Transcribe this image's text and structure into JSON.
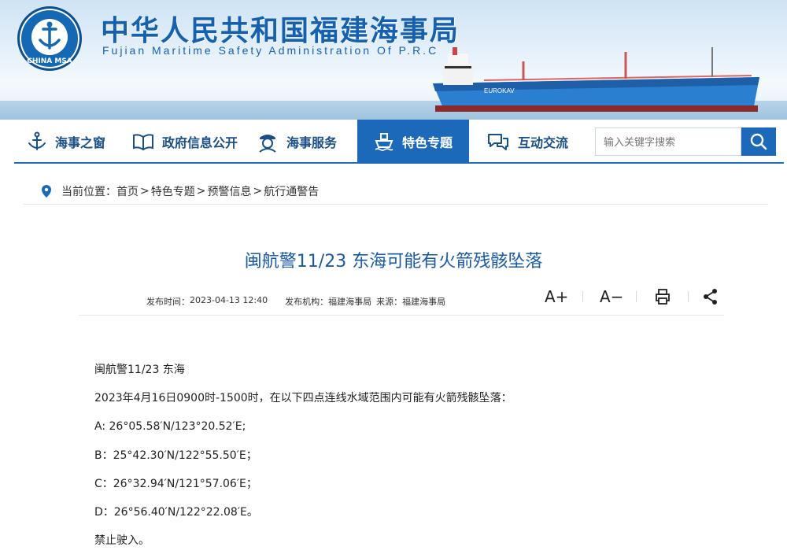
{
  "header": {
    "title": "中华人民共和国福建海事局",
    "subtitle": "Fujian Maritime Safety Administration Of P.R.C",
    "logo_text": "CHINA MSA",
    "logo_ring_text": "中国海事局",
    "ship_name": "EUROKAV",
    "logo_color": "#1468b4"
  },
  "nav": {
    "items": [
      {
        "label": "海事之窗",
        "icon": "anchor-icon"
      },
      {
        "label": "政府信息公开",
        "icon": "book-icon"
      },
      {
        "label": "海事服务",
        "icon": "officer-icon"
      },
      {
        "label": "特色专题",
        "icon": "ship-icon",
        "active": true
      },
      {
        "label": "互动交流",
        "icon": "chat-bubbles-icon"
      }
    ],
    "search_placeholder": "输入关键字搜索",
    "active_color": "#1b69b8"
  },
  "breadcrumb": {
    "prefix": "当前位置：",
    "items": [
      "首页",
      "特色专题",
      "预警信息",
      "航行通警告"
    ],
    "separator": ">"
  },
  "article": {
    "title": "闽航警11/23 东海可能有火箭残骸坠落",
    "publish_label": "发布时间：",
    "publish_time": "2023-04-13 12:40",
    "org_label": "发布机构：",
    "org": "福建海事局",
    "source_label": "来源：",
    "source": "福建海事局",
    "tools": {
      "font_increase": "A+",
      "font_decrease": "A−"
    },
    "paragraphs": [
      "闽航警11/23  东海",
      "2023年4月16日0900时-1500时，在以下四点连线水域范围内可能有火箭残骸坠落：",
      "A:  26°05.58′N/123°20.52′E;",
      "B：25°42.30′N/122°55.50′E；",
      "C：26°32.94′N/121°57.06′E；",
      "D：26°56.40′N/122°22.08′E。",
      "禁止驶入。"
    ]
  }
}
